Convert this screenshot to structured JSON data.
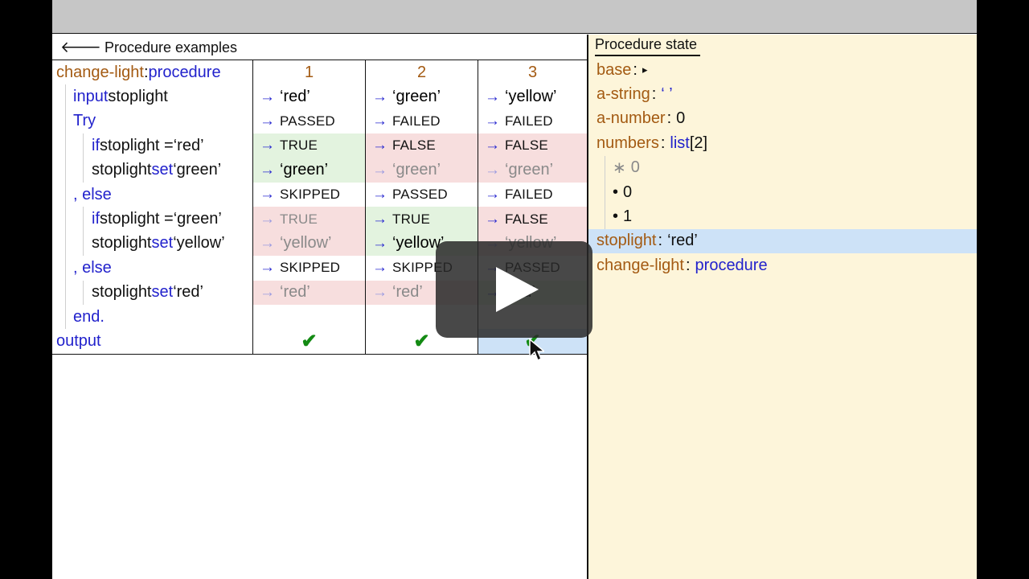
{
  "left": {
    "back_arrow": "🡐",
    "back_label": "Procedure examples",
    "code_rows": [
      {
        "parts": [
          {
            "t": "change-light",
            "c": "br"
          },
          {
            "t": ": ",
            "c": "tx"
          },
          {
            "t": "procedure",
            "c": "kw"
          }
        ],
        "indent": 0
      },
      {
        "parts": [
          {
            "t": "input ",
            "c": "kw"
          },
          {
            "t": "stoplight",
            "c": "tx"
          }
        ],
        "indent": 1
      },
      {
        "parts": [
          {
            "t": "Try",
            "c": "kw"
          }
        ],
        "indent": 1
      },
      {
        "parts": [
          {
            "t": "if ",
            "c": "kw"
          },
          {
            "t": "stoplight = ",
            "c": "tx"
          },
          {
            "t": "‘red’",
            "c": "str"
          }
        ],
        "indent": 2
      },
      {
        "parts": [
          {
            "t": "stoplight ",
            "c": "tx"
          },
          {
            "t": "set ",
            "c": "kw"
          },
          {
            "t": "‘green’",
            "c": "str"
          }
        ],
        "indent": 2
      },
      {
        "parts": [
          {
            "t": ", else",
            "c": "kw"
          }
        ],
        "indent": 1
      },
      {
        "parts": [
          {
            "t": "if ",
            "c": "kw"
          },
          {
            "t": "stoplight = ",
            "c": "tx"
          },
          {
            "t": "‘green’",
            "c": "str"
          }
        ],
        "indent": 2
      },
      {
        "parts": [
          {
            "t": "stoplight ",
            "c": "tx"
          },
          {
            "t": "set ",
            "c": "kw"
          },
          {
            "t": "‘yellow’",
            "c": "str"
          }
        ],
        "indent": 2
      },
      {
        "parts": [
          {
            "t": ", else",
            "c": "kw"
          }
        ],
        "indent": 1
      },
      {
        "parts": [
          {
            "t": "stoplight ",
            "c": "tx"
          },
          {
            "t": "set ",
            "c": "kw"
          },
          {
            "t": "‘red’",
            "c": "str"
          }
        ],
        "indent": 2
      },
      {
        "parts": [
          {
            "t": "end.",
            "c": "kw"
          }
        ],
        "indent": 1
      },
      {
        "parts": [
          {
            "t": "output",
            "c": "kw"
          }
        ],
        "indent": 0
      }
    ],
    "columns": [
      "1",
      "2",
      "3"
    ],
    "arrow_glyph": "→",
    "cells": [
      [
        null,
        null,
        null
      ],
      [
        {
          "v": "‘red’",
          "kind": "val"
        },
        {
          "v": "‘green’",
          "kind": "val"
        },
        {
          "v": "‘yellow’",
          "kind": "val"
        }
      ],
      [
        {
          "v": "PASSED",
          "kind": "status"
        },
        {
          "v": "FAILED",
          "kind": "status"
        },
        {
          "v": "FAILED",
          "kind": "status"
        }
      ],
      [
        {
          "v": "TRUE",
          "kind": "status",
          "bg": "green"
        },
        {
          "v": "FALSE",
          "kind": "status",
          "bg": "red"
        },
        {
          "v": "FALSE",
          "kind": "status",
          "bg": "red"
        }
      ],
      [
        {
          "v": "‘green’",
          "kind": "val",
          "bg": "green"
        },
        {
          "v": "‘green’",
          "kind": "val",
          "bg": "red",
          "dim": true
        },
        {
          "v": "‘green’",
          "kind": "val",
          "bg": "red",
          "dim": true
        }
      ],
      [
        {
          "v": "SKIPPED",
          "kind": "status"
        },
        {
          "v": "PASSED",
          "kind": "status"
        },
        {
          "v": "FAILED",
          "kind": "status"
        }
      ],
      [
        {
          "v": "TRUE",
          "kind": "status",
          "bg": "red",
          "dim": true
        },
        {
          "v": "TRUE",
          "kind": "status",
          "bg": "green"
        },
        {
          "v": "FALSE",
          "kind": "status",
          "bg": "red"
        }
      ],
      [
        {
          "v": "‘yellow’",
          "kind": "val",
          "bg": "red",
          "dim": true
        },
        {
          "v": "‘yellow’",
          "kind": "val",
          "bg": "green"
        },
        {
          "v": "‘yellow’",
          "kind": "val",
          "bg": "red",
          "dim": true
        }
      ],
      [
        {
          "v": "SKIPPED",
          "kind": "status"
        },
        {
          "v": "SKIPPED",
          "kind": "status"
        },
        {
          "v": "PASSED",
          "kind": "status"
        }
      ],
      [
        {
          "v": "‘red’",
          "kind": "val",
          "bg": "red",
          "dim": true
        },
        {
          "v": "‘red’",
          "kind": "val",
          "bg": "red",
          "dim": true
        },
        {
          "v": "‘red’",
          "kind": "val",
          "bg": "green"
        }
      ],
      [
        null,
        null,
        null
      ],
      [
        {
          "v": "✔",
          "kind": "check"
        },
        {
          "v": "✔",
          "kind": "check"
        },
        {
          "v": "✔",
          "kind": "check",
          "bg": "blue"
        }
      ]
    ]
  },
  "right": {
    "title": "Procedure state",
    "rows": [
      {
        "name": "base",
        "sep": ":",
        "value": "▸",
        "vc": "tx"
      },
      {
        "name": "a-string",
        "sep": ":",
        "value": "‘ ’",
        "vc": "kw"
      },
      {
        "name": "a-number",
        "sep": ":",
        "value": "0",
        "vc": "tx"
      },
      {
        "name": "numbers",
        "sep": ":",
        "value": "list",
        "vc": "kw",
        "suffix": "[2]"
      },
      {
        "bullet": "∗",
        "value": "0",
        "dim": true,
        "indent": true
      },
      {
        "bullet": "•",
        "value": "0",
        "indent": true
      },
      {
        "bullet": "•",
        "value": "1",
        "indent": true
      },
      {
        "name": "stoplight",
        "sep": ":",
        "value": "‘red’",
        "vc": "tx",
        "hl": true
      },
      {
        "name": "change-light",
        "sep": ":",
        "value": "procedure",
        "vc": "kw"
      }
    ]
  },
  "colors": {
    "name_brown": "#a35a12",
    "keyword_blue": "#2222cc",
    "pass_green": "#e3f3df",
    "fail_red": "#f7dede",
    "state_bg": "#fdf5da",
    "highlight_blue": "#cde2f7"
  },
  "overlay": {
    "icon": "play-icon"
  }
}
